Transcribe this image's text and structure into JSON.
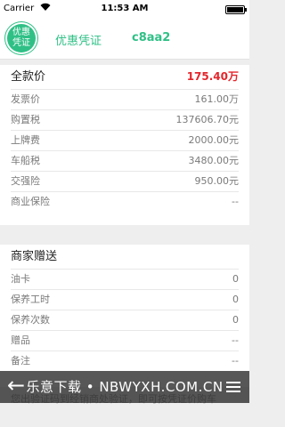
{
  "status_bar": {
    "carrier": "Carrier",
    "time": "11:53 AM",
    "battery_level": 1.0
  },
  "header": {
    "badge": "优惠凭证",
    "title": "优惠凭证",
    "code": "c8aa2"
  },
  "price_section": {
    "title": "全款价",
    "total": "175.40万",
    "rows": [
      {
        "label": "发票价",
        "value": "161.00万"
      },
      {
        "label": "购置税",
        "value": "137606.70元"
      },
      {
        "label": "上牌费",
        "value": "2000.00元"
      },
      {
        "label": "车船税",
        "value": "3480.00元"
      },
      {
        "label": "交强险",
        "value": "950.00元"
      },
      {
        "label": "商业保险",
        "value": "--"
      }
    ]
  },
  "gift_section": {
    "title": "商家赠送",
    "rows": [
      {
        "label": "油卡",
        "value": "0"
      },
      {
        "label": "保养工时",
        "value": "0"
      },
      {
        "label": "保养次数",
        "value": "0"
      },
      {
        "label": "赠品",
        "value": "--"
      },
      {
        "label": "备注",
        "value": "--"
      }
    ]
  },
  "footnote": "您出验证码到经销商处验证，即可按凭证价购车",
  "bottom_bar": {
    "watermark": "乐意下载 • NBWYXH.COM.CN"
  }
}
